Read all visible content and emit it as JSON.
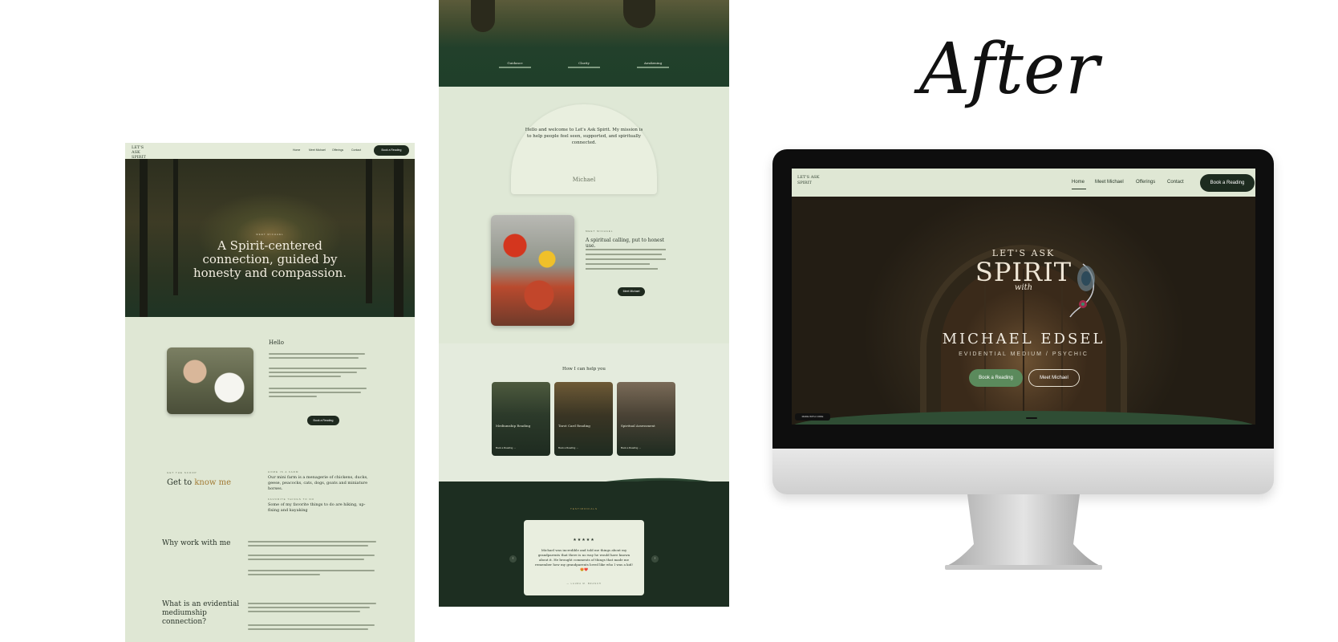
{
  "page1": {
    "logo": "LET'S ASK SPIRIT",
    "nav": [
      "Home",
      "Meet Michael",
      "Offerings",
      "Contact"
    ],
    "nav_cta": "Book a Reading",
    "hero_eyebrow": "MEET MICHAEL",
    "hero_title": "A Spirit-centered connection, guided by honesty and compassion.",
    "hello": "Hello",
    "book_button": "Book a Reading",
    "gtk_eyebrow": "GET THE SCOOP",
    "gtk_title": "Get to ",
    "gtk_accent": "know me",
    "fact1_label": "HOME IS A FARM",
    "fact1_text": "Our mini farm is a menagerie of chickens, ducks, geese, peacocks, cats, dogs, goats and miniature horses.",
    "fact2_label": "FAVORITE THINGS TO DO",
    "fact2_text": "Some of my favorite things to do are hiking, up-fixing and kayaking",
    "why_title": "Why work with me",
    "what_title": "What is an evidential mediumship connection?"
  },
  "page2": {
    "icons": [
      "Guidance",
      "Clarity",
      "Awakening"
    ],
    "welcome": "Hello and welcome to Let's Ask Spirit. My mission is to help people feel seen, supported, and spiritually connected.",
    "signature": "Michael",
    "eyebrow": "MEET MICHAEL",
    "calling": "A spiritual calling, put to honest use.",
    "meet_button": "Meet Michael",
    "help_title": "How I can help you",
    "cards": [
      {
        "title": "Mediumship Reading",
        "cta": "Book a Reading →"
      },
      {
        "title": "Tarot Card Reading",
        "cta": "Book a Reading →"
      },
      {
        "title": "Spiritual Assessment",
        "cta": "Book a Reading →"
      }
    ],
    "testimonials_eyebrow": "TESTIMONIALS",
    "stars": "★★★★★",
    "quote": "Michael was incredible and told me things about my grandparents that there is no way he would have known about it. He brought comments of things that made me remember how my grandparents loved like who I was a kid! 😍❤️",
    "quote_author": "— LAURA M. BRANCH",
    "arrow_left": "‹",
    "arrow_right": "›"
  },
  "after": "After",
  "screen": {
    "logo": "LET'S ASK SPIRIT",
    "nav": [
      "Home",
      "Meet Michael",
      "Offerings",
      "Contact"
    ],
    "nav_cta": "Book a Reading",
    "lets_ask": "LET'S ASK",
    "spirit": "SPIRIT",
    "with": "with",
    "name": "MICHAEL EDSEL",
    "subtitle": "EVIDENTIAL MEDIUM / PSYCHIC",
    "btn_primary": "Book a Reading",
    "btn_secondary": "Meet Michael",
    "badge": "MADE WITH CODE"
  },
  "colors": {
    "sage": "#dfe7d4",
    "forest": "#1d2e21",
    "accent_gold": "#a27a33",
    "button_green": "#5b8a5c"
  }
}
